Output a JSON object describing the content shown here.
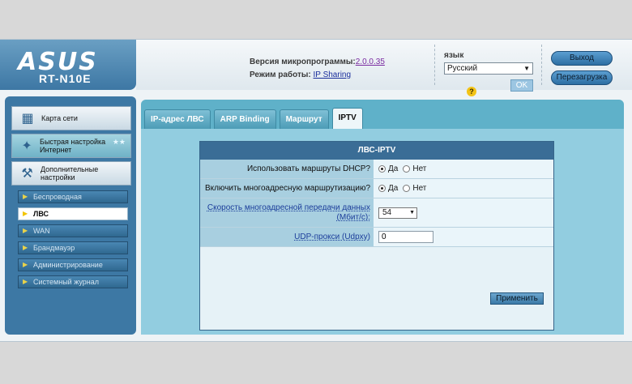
{
  "header": {
    "brand": "ASUS",
    "model": "RT-N10E",
    "firmware_label": "Версия микропрограммы:",
    "firmware_value": "2.0.0.35",
    "mode_label": "Режим работы:",
    "mode_value": "IP Sharing",
    "language_label": "язык",
    "language_value": "Русский",
    "ok_label": "OK",
    "logout_label": "Выход",
    "reboot_label": "Перезагрузка"
  },
  "sidebar": {
    "main_items": [
      {
        "label": "Карта сети",
        "icon": "network-map-icon"
      },
      {
        "label": "Быстрая настройка Интернет",
        "icon": "wand-icon"
      },
      {
        "label": "Дополнительные настройки",
        "icon": "tools-icon"
      }
    ],
    "sub_items": [
      {
        "label": "Беспроводная"
      },
      {
        "label": "ЛВС"
      },
      {
        "label": "WAN"
      },
      {
        "label": "Брандмауэр"
      },
      {
        "label": "Администрирование"
      },
      {
        "label": "Системный журнал"
      }
    ]
  },
  "tabs": [
    {
      "label": "IP-адрес ЛВС"
    },
    {
      "label": "ARP Binding"
    },
    {
      "label": "Маршрут"
    },
    {
      "label": "IPTV"
    }
  ],
  "panel": {
    "title": "ЛВС-IPTV",
    "rows": {
      "dhcp_routes": {
        "label": "Использовать маршруты DHCP?",
        "yes": "Да",
        "no": "Нет",
        "selected": "yes"
      },
      "multicast": {
        "label": "Включить многоадресную маршрутизацию?",
        "yes": "Да",
        "no": "Нет",
        "selected": "yes"
      },
      "speed": {
        "label": "Скорость многоадресной передачи данных (Мбит/с):",
        "value": "54"
      },
      "udpxy": {
        "label": "UDP-прокси (Udpxy)",
        "value": "0"
      }
    },
    "apply_label": "Применить"
  },
  "help_label": "?"
}
